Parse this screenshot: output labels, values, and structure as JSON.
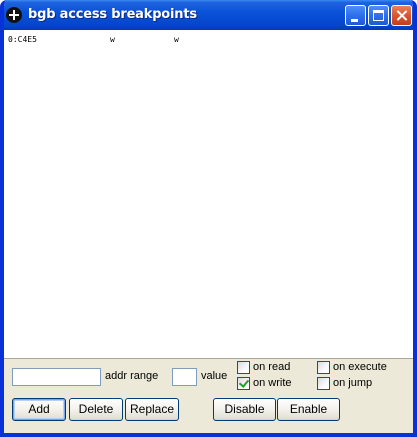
{
  "window": {
    "title": "bgb access breakpoints"
  },
  "titlebar": {
    "icons": [
      "app-icon",
      "minimize-icon",
      "maximize-icon",
      "close-icon"
    ]
  },
  "breakpoints": [
    {
      "address": "0:C4E5",
      "col2": "w",
      "col3": "w"
    }
  ],
  "form": {
    "addr_range_value": "",
    "addr_range_label": "addr range",
    "value_value": "",
    "value_label": "value",
    "checkboxes": {
      "on_read": {
        "label": "on read",
        "checked": false
      },
      "on_write": {
        "label": "on write",
        "checked": true
      },
      "on_execute": {
        "label": "on execute",
        "checked": false
      },
      "on_jump": {
        "label": "on jump",
        "checked": false
      }
    }
  },
  "buttons": {
    "add": "Add",
    "delete": "Delete",
    "replace": "Replace",
    "disable": "Disable",
    "enable": "Enable"
  },
  "colors": {
    "titlebar": "#0A52D8",
    "frame": "#0831D9",
    "dialog_bg": "#ECE9D8",
    "checkmark": "#21A121"
  }
}
